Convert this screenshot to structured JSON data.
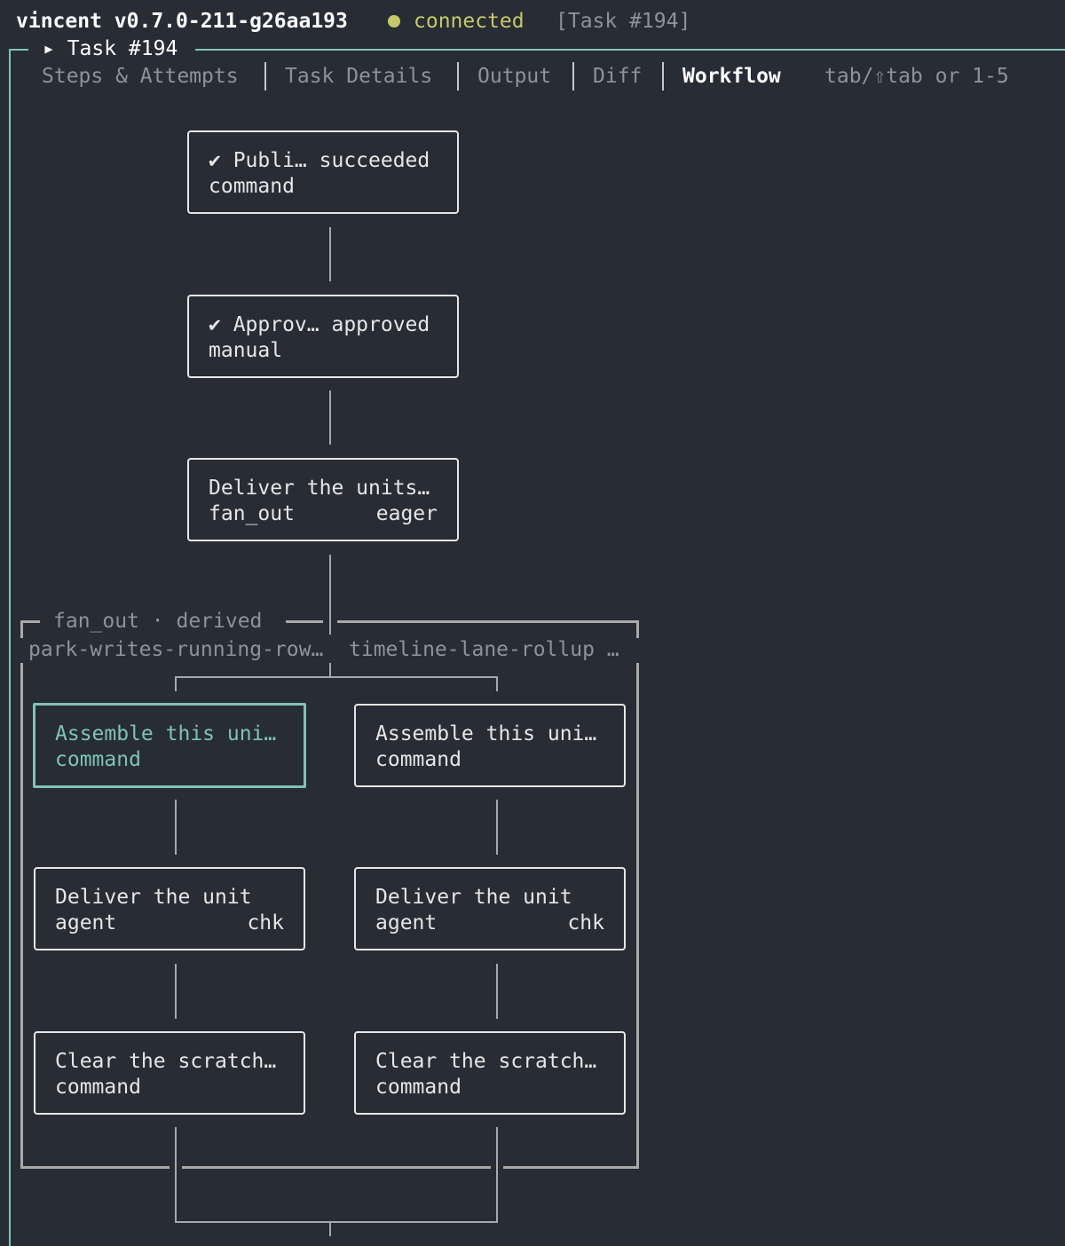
{
  "status_bar": {
    "app_name": "vincent v0.7.0-211-g26aa193",
    "connection": "connected",
    "task_ref": "[Task #194]"
  },
  "frame": {
    "title": "▸ Task #194"
  },
  "tabs": [
    {
      "label": "Steps & Attempts",
      "active": false
    },
    {
      "label": "Task Details",
      "active": false
    },
    {
      "label": "Output",
      "active": false
    },
    {
      "label": "Diff",
      "active": false
    },
    {
      "label": "Workflow",
      "active": true
    }
  ],
  "tab_hint": "tab/⇧tab or 1-5",
  "workflow": {
    "nodes": [
      {
        "line1": "✔ Publi… succeeded",
        "line2": "command"
      },
      {
        "line1": "✔ Approv… approved",
        "line2": "manual"
      },
      {
        "line1": "Deliver the units…",
        "kind": "fan_out",
        "mode": "eager"
      }
    ],
    "group": {
      "title": "fan_out · derived",
      "branch_labels": [
        "park-writes-running-row…",
        "timeline-lane-rollup …"
      ],
      "branches": [
        {
          "nodes": [
            {
              "line1": "Assemble this uni…",
              "line2": "command",
              "selected": true
            },
            {
              "line1": "Deliver the unit",
              "kind": "agent",
              "tag": "chk"
            },
            {
              "line1": "Clear the scratch…",
              "line2": "command"
            }
          ]
        },
        {
          "nodes": [
            {
              "line1": "Assemble this uni…",
              "line2": "command",
              "selected": false
            },
            {
              "line1": "Deliver the unit",
              "kind": "agent",
              "tag": "chk"
            },
            {
              "line1": "Clear the scratch…",
              "line2": "command"
            }
          ]
        }
      ]
    }
  },
  "colors": {
    "background": "#282c34",
    "accent": "#7fc2b6",
    "connected": "#c5c96a",
    "muted": "#8d929b"
  }
}
